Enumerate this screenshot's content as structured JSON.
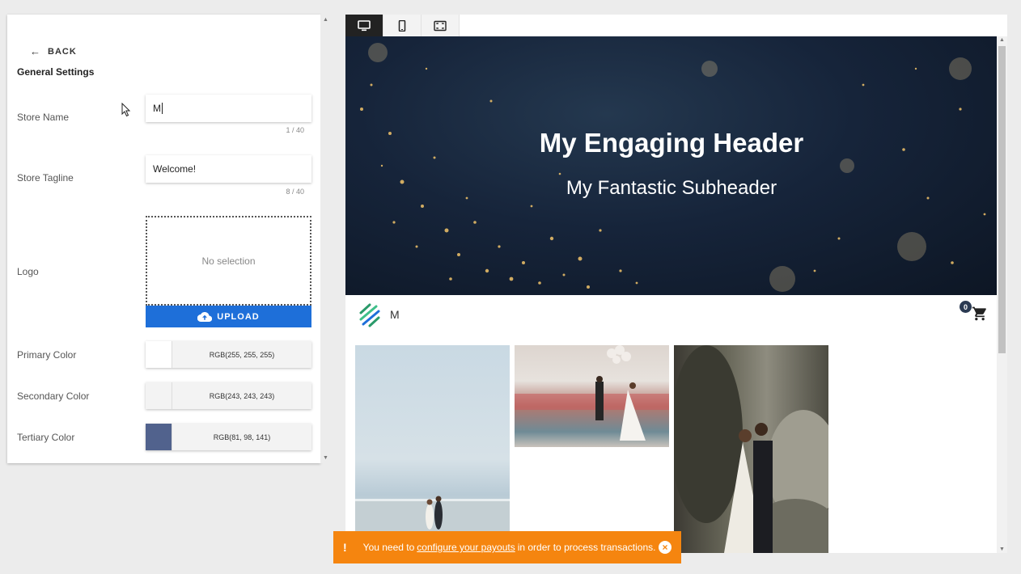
{
  "settings": {
    "back_label": "BACK",
    "section_title": "General Settings",
    "store_name": {
      "label": "Store Name",
      "value": "M",
      "counter": "1 / 40"
    },
    "store_tagline": {
      "label": "Store Tagline",
      "value": "Welcome!",
      "counter": "8 / 40"
    },
    "logo": {
      "label": "Logo",
      "empty_text": "No selection",
      "upload_label": "UPLOAD"
    },
    "primary_color": {
      "label": "Primary Color",
      "value": "RGB(255, 255, 255)",
      "hex": "#ffffff"
    },
    "secondary_color": {
      "label": "Secondary Color",
      "value": "RGB(243, 243, 243)",
      "hex": "#f3f3f3"
    },
    "tertiary_color": {
      "label": "Tertiary Color",
      "value": "RGB(81, 98, 141)",
      "hex": "#51628d"
    }
  },
  "preview": {
    "device_tabs": [
      "desktop-icon",
      "mobile-icon",
      "fullscreen-icon"
    ],
    "active_tab": "desktop",
    "hero_title": "My Engaging Header",
    "hero_subtitle": "My Fantastic Subheader",
    "store_name": "M",
    "cart_count": "0"
  },
  "notification": {
    "prefix": "You need to",
    "link": "configure your payouts",
    "suffix": "in order to process transactions."
  },
  "colors": {
    "accent": "#1e6fd9",
    "warning": "#f5850f"
  }
}
